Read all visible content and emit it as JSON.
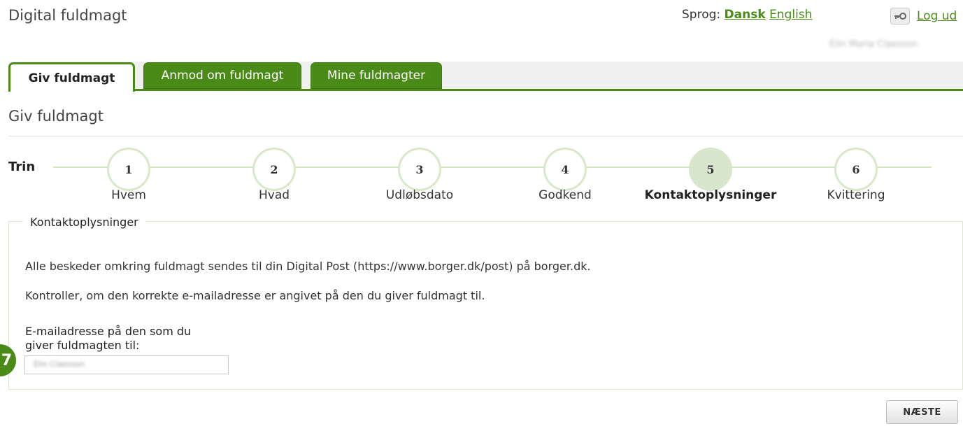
{
  "header": {
    "app_title": "Digital fuldmagt",
    "language_prefix": "Sprog:",
    "language_active": "Dansk",
    "language_other": "English",
    "logout_icon": "key-icon",
    "logout_label": "Log ud",
    "user_name": "Elin Maria Claesson"
  },
  "tabs": [
    {
      "label": "Giv fuldmagt",
      "active": true
    },
    {
      "label": "Anmod om fuldmagt",
      "active": false
    },
    {
      "label": "Mine fuldmagter",
      "active": false
    }
  ],
  "page": {
    "title": "Giv fuldmagt"
  },
  "stepper": {
    "label": "Trin",
    "current_step": 5,
    "steps": [
      {
        "number": "1",
        "label": "Hvem"
      },
      {
        "number": "2",
        "label": "Hvad"
      },
      {
        "number": "3",
        "label": "Udløbsdato"
      },
      {
        "number": "4",
        "label": "Godkend"
      },
      {
        "number": "5",
        "label": "Kontaktoplysninger"
      },
      {
        "number": "6",
        "label": "Kvittering"
      }
    ]
  },
  "contact": {
    "legend": "Kontaktoplysninger",
    "info_1": "Alle beskeder omkring fuldmagt sendes til din Digital Post (https://www.borger.dk/post) på borger.dk.",
    "info_2": "Kontroller, om den korrekte e-mailadresse er angivet på den du giver fuldmagt til.",
    "email_label_line1": "E-mailadresse på den som du",
    "email_label_line2": "giver fuldmagten til:",
    "email_value": "Elin Claesson"
  },
  "help": {
    "badge_text": "7"
  },
  "actions": {
    "next_label": "NÆSTE"
  },
  "colors": {
    "accent": "#4a8a16",
    "step_current_bg": "#d8e6cb",
    "step_border": "#d8e8c8"
  }
}
